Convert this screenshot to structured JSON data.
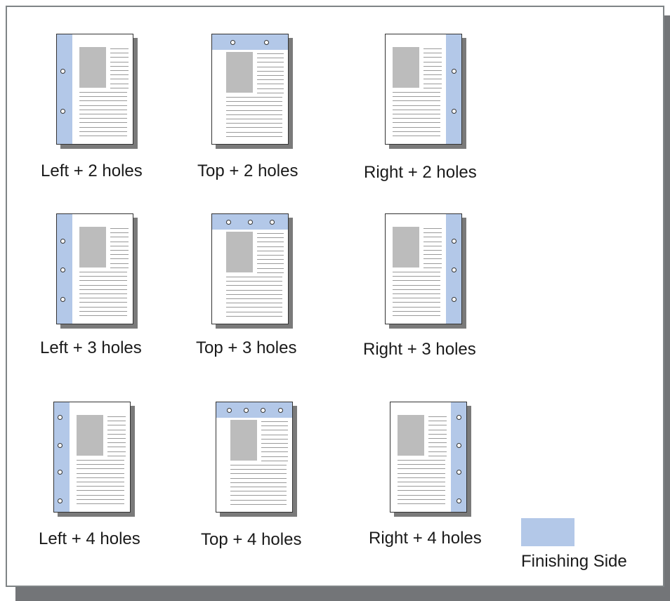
{
  "colors": {
    "finishing_side": "#b3c8e8",
    "frame_shadow": "#737578",
    "picture_block": "#bcbcbc"
  },
  "options": [
    {
      "side": "left",
      "holes": 2,
      "label": "Left + 2 holes"
    },
    {
      "side": "top",
      "holes": 2,
      "label": "Top + 2 holes"
    },
    {
      "side": "right",
      "holes": 2,
      "label": "Right + 2 holes"
    },
    {
      "side": "left",
      "holes": 3,
      "label": "Left + 3 holes"
    },
    {
      "side": "top",
      "holes": 3,
      "label": "Top + 3 holes"
    },
    {
      "side": "right",
      "holes": 3,
      "label": "Right + 3 holes"
    },
    {
      "side": "left",
      "holes": 4,
      "label": "Left + 4 holes"
    },
    {
      "side": "top",
      "holes": 4,
      "label": "Top + 4 holes"
    },
    {
      "side": "right",
      "holes": 4,
      "label": "Right + 4 holes"
    }
  ],
  "legend": {
    "label": "Finishing Side"
  }
}
